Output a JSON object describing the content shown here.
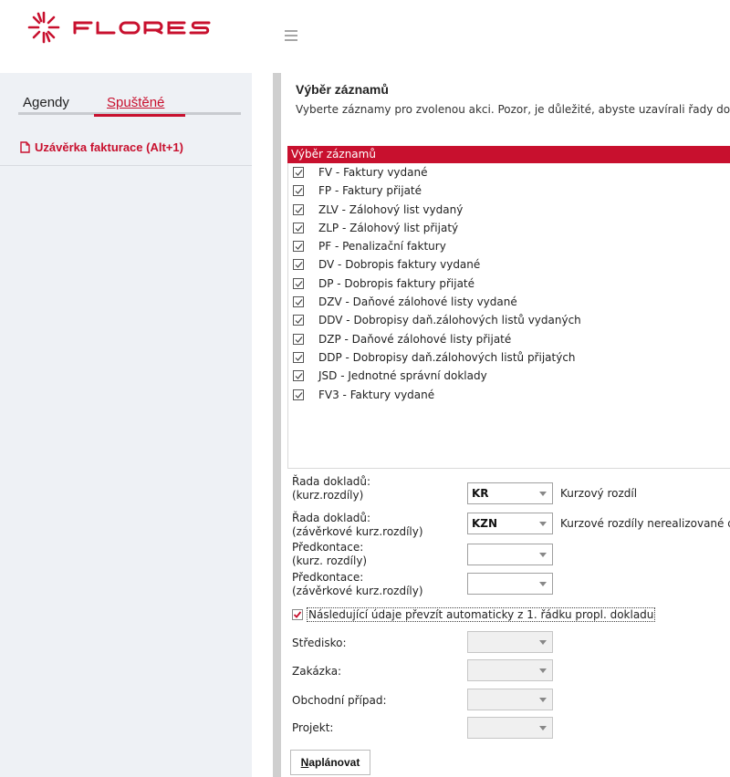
{
  "header": {
    "logo_text": "FLORES",
    "brand_color": "#c8102e",
    "menu_icon": "hamburger-icon"
  },
  "sidebar": {
    "tabs": [
      {
        "label": "Agendy",
        "active": false
      },
      {
        "label": "Spuštěné",
        "active": true
      }
    ],
    "items": [
      {
        "label": "Uzávěrka fakturace (Alt+1)",
        "icon": "document-icon"
      }
    ]
  },
  "main": {
    "title": "Výběr záznamů",
    "description": "Vyberte záznamy pro zvolenou akci. Pozor, je důležité, abyste uzavírali řady dobro",
    "list": {
      "header": "Výběr záznamů",
      "items": [
        {
          "label": "FV - Faktury vydané",
          "checked": true
        },
        {
          "label": "FP - Faktury přijaté",
          "checked": true
        },
        {
          "label": "ZLV - Zálohový list vydaný",
          "checked": true
        },
        {
          "label": "ZLP - Zálohový list přijatý",
          "checked": true
        },
        {
          "label": "PF - Penalizační faktury",
          "checked": true
        },
        {
          "label": "DV - Dobropis faktury vydané",
          "checked": true
        },
        {
          "label": "DP - Dobropis faktury přijaté",
          "checked": true
        },
        {
          "label": "DZV - Daňové zálohové listy vydané",
          "checked": true
        },
        {
          "label": "DDV - Dobropisy daň.zálohových listů vydaných",
          "checked": true
        },
        {
          "label": "DZP - Daňové zálohové listy přijaté",
          "checked": true
        },
        {
          "label": "DDP - Dobropisy daň.zálohových listů přijatých",
          "checked": true
        },
        {
          "label": "JSD - Jednotné správní doklady",
          "checked": true
        },
        {
          "label": "FV3 - Faktury vydané",
          "checked": true
        }
      ]
    },
    "form": {
      "rada1": {
        "label1": "Řada dokladů:",
        "label2": "(kurz.rozdíly)",
        "value": "KR",
        "description": "Kurzový rozdíl"
      },
      "rada2": {
        "label1": "Řada dokladů:",
        "label2": "(závěrkové kurz.rozdíly)",
        "value": "KZN",
        "description": "Kurzové rozdíly nerealizované da"
      },
      "predkontace1": {
        "label1": "Předkontace:",
        "label2": "(kurz. rozdíly)",
        "value": ""
      },
      "predkontace2": {
        "label1": "Předkontace:",
        "label2": "(závěrkové kurz.rozdíly)",
        "value": ""
      },
      "auto": {
        "label": "Následující údaje převzít automaticky z 1. řádku propl. dokladu",
        "checked": true
      },
      "stredisko": {
        "label": "Středisko:",
        "value": ""
      },
      "zakazka": {
        "label": "Zakázka:",
        "value": ""
      },
      "obchodni_pripad": {
        "label": "Obchodní případ:",
        "value": ""
      },
      "projekt": {
        "label": "Projekt:",
        "value": ""
      }
    },
    "button": {
      "mnemonic": "N",
      "rest": "aplánovat"
    }
  }
}
